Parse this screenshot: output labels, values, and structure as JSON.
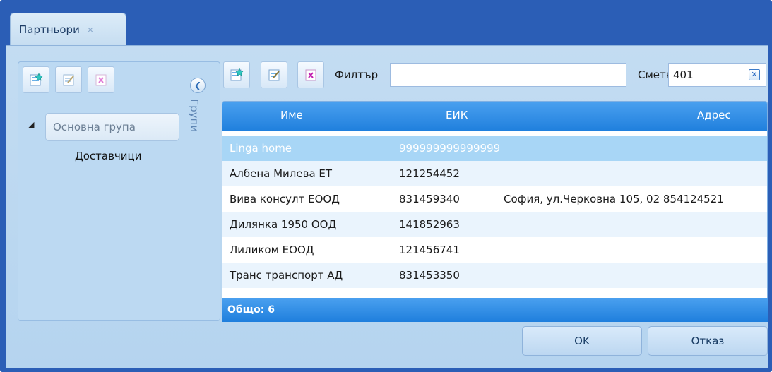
{
  "tab": {
    "title": "Партньори",
    "close_glyph": "⨯"
  },
  "groups": {
    "panel_label": "Групи",
    "tree": {
      "root": "Основна група",
      "child": "Доставчици"
    },
    "toolbar": {
      "add_icon": "add-icon",
      "edit_icon": "edit-icon",
      "delete_icon": "delete-icon"
    }
  },
  "filter": {
    "label": "Филтър",
    "value": ""
  },
  "account": {
    "label": "Сметка",
    "value": "401"
  },
  "grid": {
    "columns": [
      "Име",
      "ЕИК",
      "Адрес"
    ],
    "rows": [
      {
        "name": "Linga home",
        "eik": "999999999999999",
        "address": ""
      },
      {
        "name": "Албена Милева ЕТ",
        "eik": "121254452",
        "address": ""
      },
      {
        "name": "Вива консулт ЕООД",
        "eik": "831459340",
        "address": "София, ул.Черковна 105, 02 854124521"
      },
      {
        "name": "Дилянка 1950 ООД",
        "eik": "141852963",
        "address": ""
      },
      {
        "name": "Лиликом ЕООД",
        "eik": "121456741",
        "address": ""
      },
      {
        "name": "Транс транспорт АД",
        "eik": "831453350",
        "address": ""
      }
    ],
    "footer": "Общо: 6"
  },
  "buttons": {
    "ok": "OK",
    "cancel": "Отказ"
  },
  "colors": {
    "window": "#2b5eb6",
    "header": "#2a8ae6",
    "selected_row": "#a8d6f6",
    "panel": "#bcd9f2"
  }
}
